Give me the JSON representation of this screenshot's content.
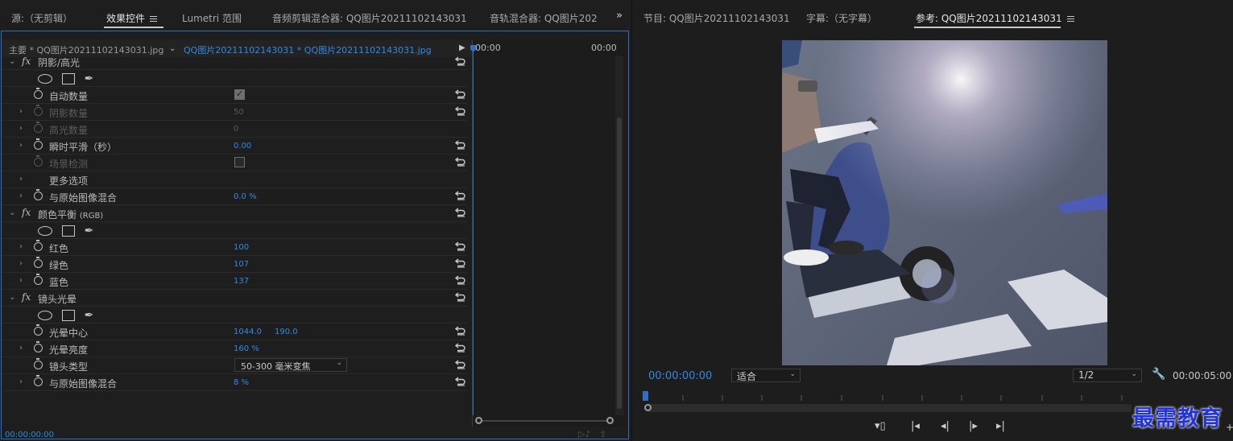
{
  "left_tabs": [
    {
      "label": "源:（无剪辑）"
    },
    {
      "label": "效果控件",
      "active": true
    },
    {
      "label": "Lumetri 范围"
    },
    {
      "label": "音频剪辑混合器: QQ图片20211102143031"
    },
    {
      "label": "音轨混合器: QQ图片202"
    }
  ],
  "source_row": {
    "master_label": "主要 * QQ图片20211102143031.jpg",
    "clip_label": "QQ图片20211102143031 * QQ图片20211102143031.jpg"
  },
  "timeline_mini": {
    "start_time": "00:00",
    "end_time": "00:00"
  },
  "effects": {
    "shadow_highlight": {
      "title": "阴影/高光",
      "auto_amounts_label": "自动数量",
      "auto_amounts_checked": true,
      "shadow_amount_label": "阴影数量",
      "shadow_amount_value": "50",
      "highlight_amount_label": "高光数量",
      "highlight_amount_value": "0",
      "temporal_smoothing_label": "瞬时平滑（秒）",
      "temporal_smoothing_value": "0.00",
      "scene_detect_label": "场景检测",
      "more_options_label": "更多选项",
      "blend_label": "与原始图像混合",
      "blend_value": "0.0 %"
    },
    "color_balance": {
      "title": "颜色平衡",
      "title_suffix": "(RGB)",
      "red_label": "红色",
      "red_value": "100",
      "green_label": "绿色",
      "green_value": "107",
      "blue_label": "蓝色",
      "blue_value": "137"
    },
    "lens_flare": {
      "title": "镜头光晕",
      "center_label": "光晕中心",
      "center_x": "1044.0",
      "center_y": "190.0",
      "brightness_label": "光晕亮度",
      "brightness_value": "160 %",
      "lens_type_label": "镜头类型",
      "lens_type_value": "50-300 毫米变焦",
      "blend_label": "与原始图像混合",
      "blend_value": "8 %"
    }
  },
  "left_bottom_time": "00:00:00:00",
  "right_tabs": [
    {
      "label": "节目: QQ图片20211102143031"
    },
    {
      "label": "字幕:（无字幕）"
    },
    {
      "label": "参考: QQ图片20211102143031",
      "active": true
    }
  ],
  "monitor": {
    "current_time": "00:00:00:00",
    "fit_label": "适合",
    "resolution_label": "1/2",
    "duration": "00:00:05:00"
  },
  "watermark": "最需教育",
  "colors": {
    "accent": "#2f8ae3",
    "panel": "#1e1e1e",
    "frame": "#2d6fc1"
  }
}
